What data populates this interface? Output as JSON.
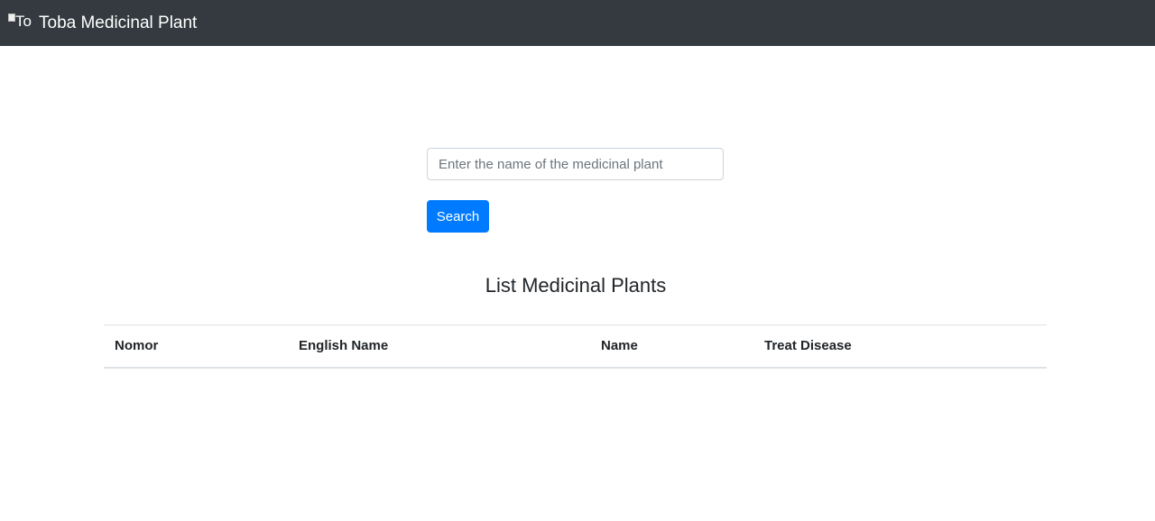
{
  "navbar": {
    "logo_alt": "Toba Medicinal Plant",
    "logo_visible_text": "To",
    "brand": "Toba Medicinal Plant",
    "background_color": "#343a40"
  },
  "search": {
    "placeholder": "Enter the name of the medicinal plant",
    "value": "",
    "button_label": "Search",
    "button_color": "#007bff"
  },
  "main": {
    "title": "List Medicinal Plants",
    "table": {
      "columns": [
        "Nomor",
        "English Name",
        "Name",
        "Treat Disease"
      ],
      "rows": []
    }
  }
}
